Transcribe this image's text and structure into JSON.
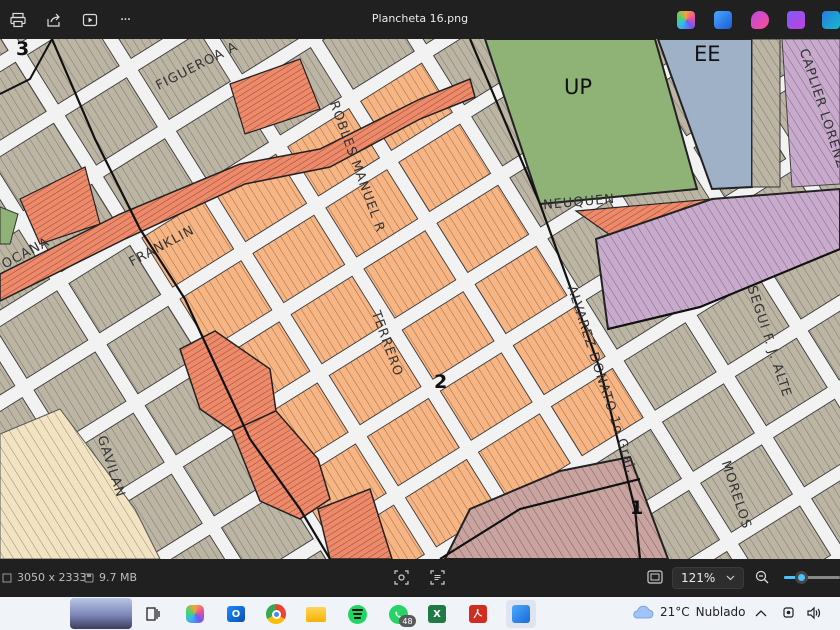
{
  "window": {
    "title": "Plancheta 16.png",
    "toolbar_icons": [
      "print-icon",
      "share-icon",
      "slideshow-icon",
      "more-icon"
    ],
    "more_label": "···",
    "app_icons": [
      "copilot-icon",
      "designer-icon",
      "clipchamp-icon",
      "stream-icon",
      "photos-icon"
    ]
  },
  "map": {
    "streets": {
      "figueroa": "FIGUEROA  A",
      "robles": "ROBLES MANUEL R",
      "franklin": "FRANKLIN",
      "ocana": "OCANA",
      "neuquen": "NEUQUEN",
      "terrero": "TERRERO",
      "alvarez": "ALVAREZ DONATO 1o Gral.",
      "segui": "SEGUI F. J. ALTE",
      "gavilan": "GAVILAN",
      "morelos": "MORELOS",
      "lorenzo": "CAPLIER LORENZO"
    },
    "zones": {
      "up": "UP",
      "ee": "EE",
      "z1": "1",
      "z2": "2",
      "z3": "3"
    },
    "colors": {
      "tan": "#bcb5a4",
      "orange_light": "#f7b584",
      "orange_dark": "#ee8a6a",
      "green": "#8fb276",
      "blue": "#9fb1c7",
      "purple": "#c8aacd",
      "cream": "#f2e3c2",
      "mauve": "#c9a3a0",
      "street": "#f2f2f2"
    }
  },
  "status": {
    "dimensions": "3050 x 2333",
    "filesize": "9.7 MB",
    "zoom": "121%",
    "zoom_level": 0.3
  },
  "taskbar": {
    "weather_temp": "21°C",
    "weather_desc": "Nublado",
    "whatsapp_badge": "48",
    "apps": [
      "widgets-icon",
      "copilot-icon",
      "outlook-icon",
      "chrome-icon",
      "explorer-icon",
      "spotify-icon",
      "whatsapp-icon",
      "excel-icon",
      "acrobat-icon",
      "photos-icon"
    ]
  }
}
